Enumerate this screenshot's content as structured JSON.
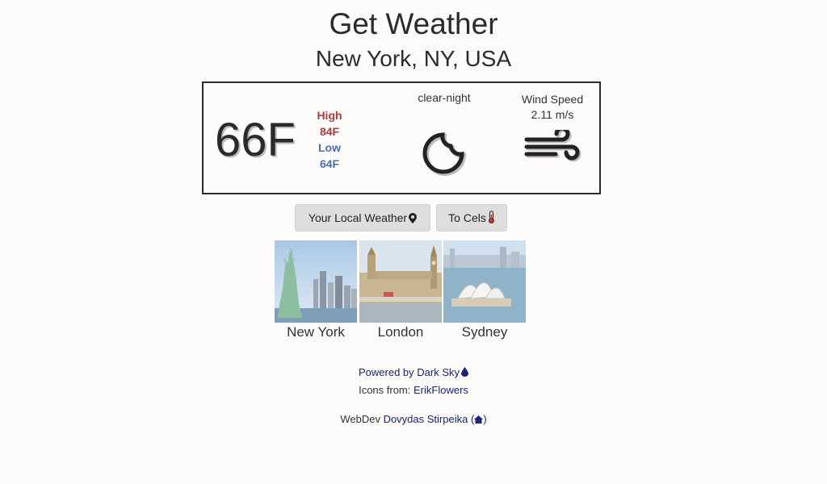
{
  "header": {
    "title": "Get Weather",
    "location": "New York, NY, USA"
  },
  "weather": {
    "temperature": "66F",
    "high_label": "High",
    "high_value": "84F",
    "low_label": "Low",
    "low_value": "64F",
    "condition": "clear-night",
    "condition_icon": "moon-icon",
    "wind_label": "Wind Speed",
    "wind_value": "2.11 m/s",
    "wind_icon": "wind-icon"
  },
  "buttons": {
    "local_weather": "Your Local Weather",
    "local_icon": "map-marker-icon",
    "to_celsius": "To Cels",
    "celsius_icon": "thermometer-icon"
  },
  "cities": [
    {
      "name": "New York",
      "image": "statue-of-liberty-image"
    },
    {
      "name": "London",
      "image": "big-ben-image"
    },
    {
      "name": "Sydney",
      "image": "opera-house-image"
    }
  ],
  "footer": {
    "powered_by": "Powered by Dark Sky",
    "icons_prefix": "Icons from: ",
    "icons_link": "ErikFlowers",
    "webdev_prefix": "WebDev ",
    "webdev_link": "Dovydas Stirpeika",
    "webdev_icon": "home-icon"
  },
  "colors": {
    "high": "#b23a3a",
    "low": "#4a6fb0",
    "link": "#1a237e",
    "button_bg": "#dedede"
  }
}
